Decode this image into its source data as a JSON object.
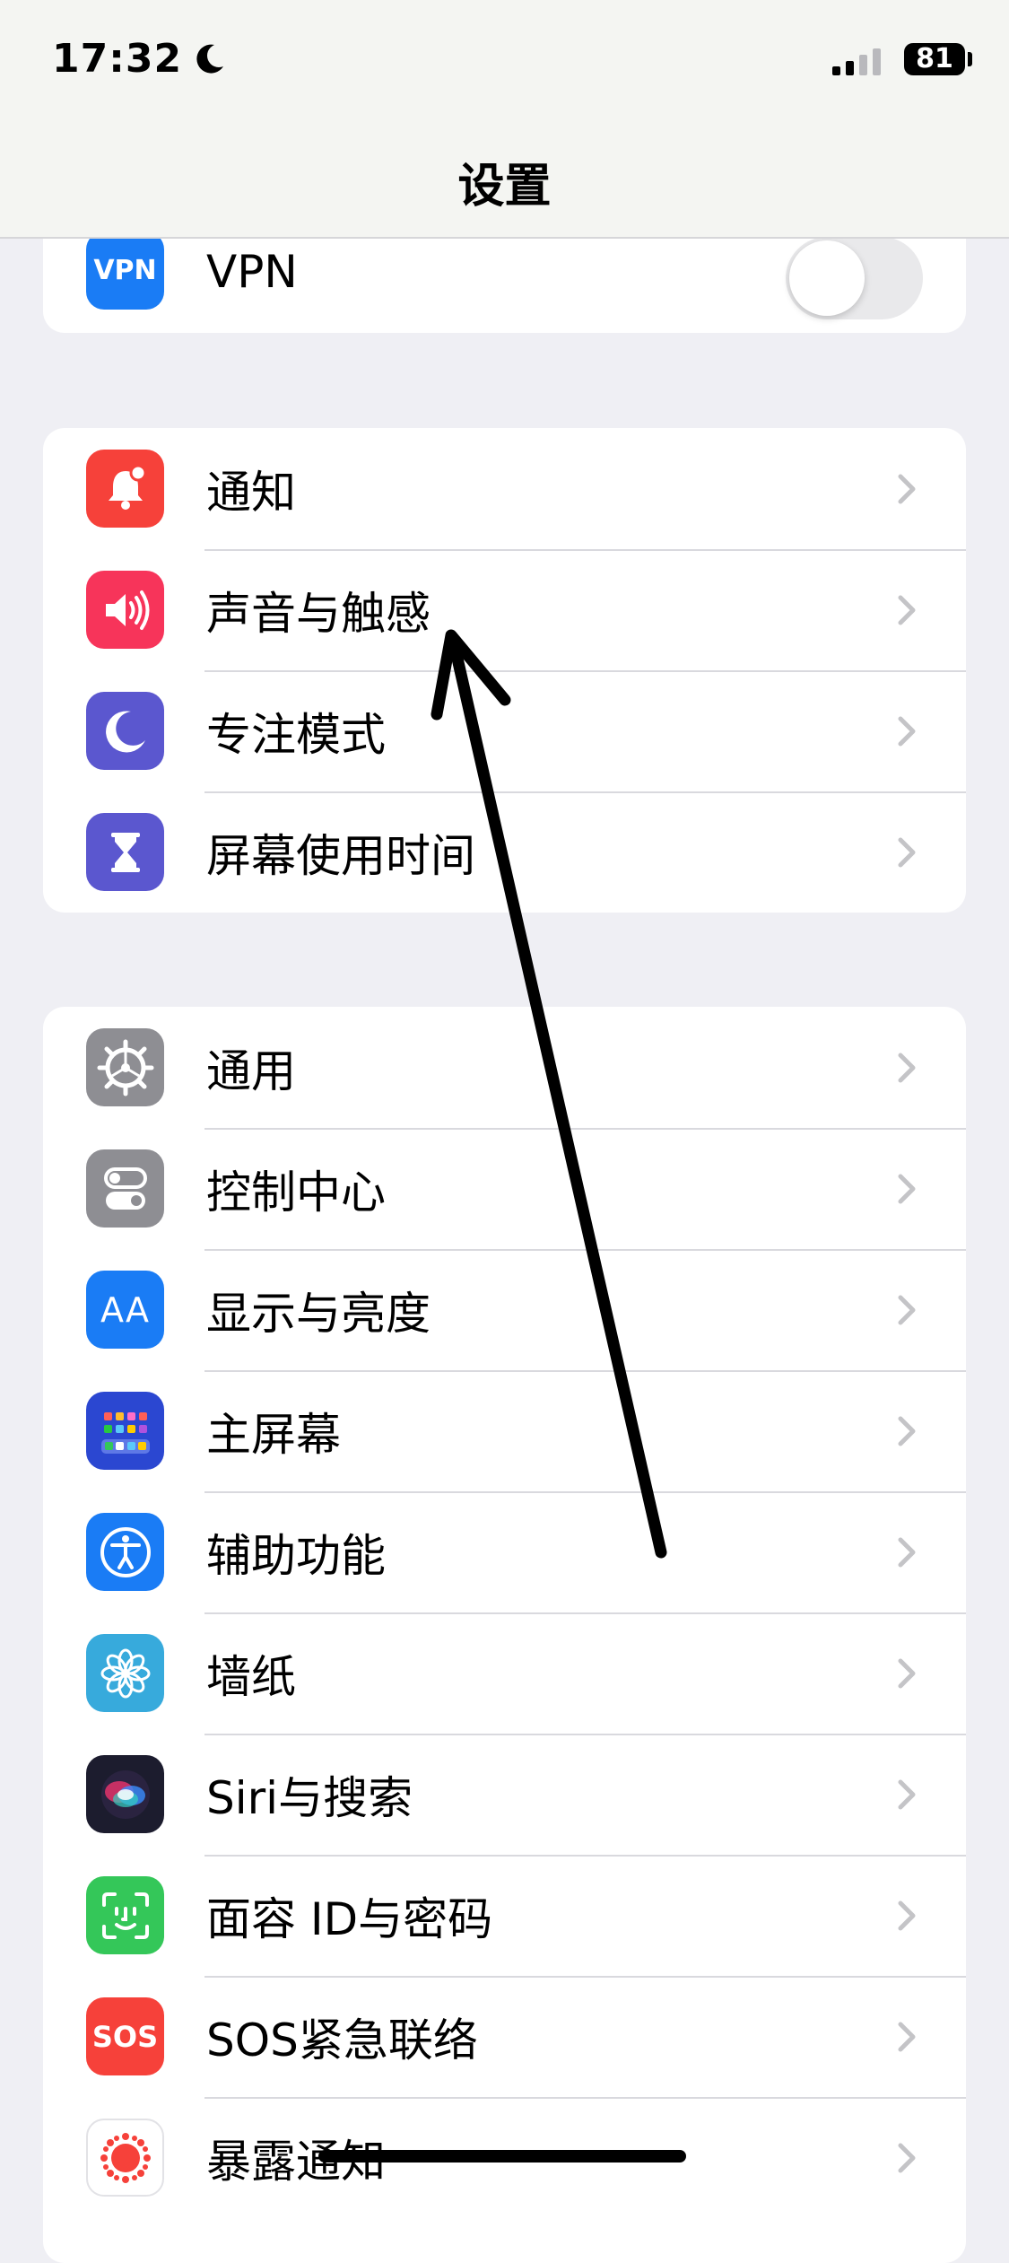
{
  "status_bar": {
    "time": "17:32",
    "focus_icon": "moon-icon",
    "battery": "81"
  },
  "nav": {
    "title": "设置"
  },
  "vpn_group": {
    "vpn": {
      "label": "VPN",
      "icon_text": "VPN",
      "icon": "vpn-icon",
      "color": "#1a7cf5",
      "toggle_on": false
    }
  },
  "group1": {
    "items": [
      {
        "label": "通知",
        "icon": "bell-icon",
        "color": "#f6413a"
      },
      {
        "label": "声音与触感",
        "icon": "speaker-icon",
        "color": "#f7345a"
      },
      {
        "label": "专注模式",
        "icon": "moon-icon",
        "color": "#5b57cf"
      },
      {
        "label": "屏幕使用时间",
        "icon": "hourglass-icon",
        "color": "#5b57cf"
      }
    ]
  },
  "group2": {
    "items": [
      {
        "label": "通用",
        "icon": "gear-icon",
        "color": "#8e8e93"
      },
      {
        "label": "控制中心",
        "icon": "switches-icon",
        "color": "#8e8e93"
      },
      {
        "label": "显示与亮度",
        "icon": "text-size-icon",
        "color": "#1a7cf5",
        "icon_text": "AA"
      },
      {
        "label": "主屏幕",
        "icon": "home-screen-icon",
        "color": "#2b47d1"
      },
      {
        "label": "辅助功能",
        "icon": "accessibility-icon",
        "color": "#1a7cf5"
      },
      {
        "label": "墙纸",
        "icon": "flower-icon",
        "color": "#37aadc"
      },
      {
        "label": "Siri与搜索",
        "icon": "siri-icon",
        "color": "#1c1c2e"
      },
      {
        "label": "面容 ID与密码",
        "icon": "face-id-icon",
        "color": "#34c759"
      },
      {
        "label": "SOS紧急联络",
        "icon": "sos-icon",
        "color": "#f6413a",
        "icon_text": "SOS"
      },
      {
        "label": "暴露通知",
        "icon": "exposure-icon",
        "color": "#ffffff"
      }
    ]
  }
}
